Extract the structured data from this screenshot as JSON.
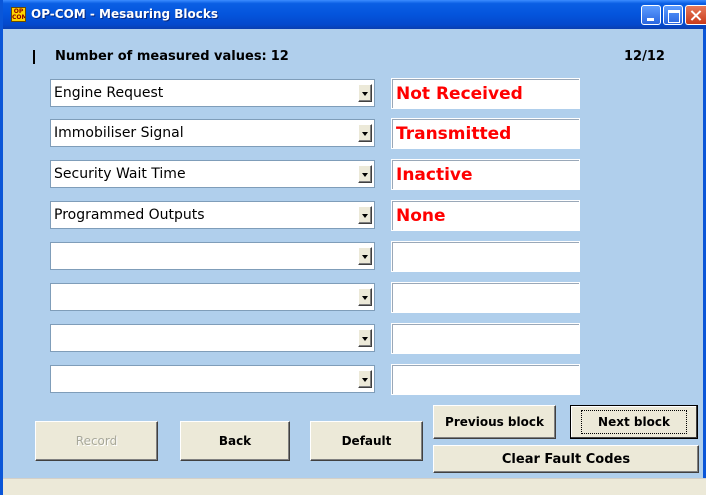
{
  "window": {
    "title": "OP-COM - Mesauring Blocks",
    "icon_text": "OP COM",
    "icon": "op-com-logo-icon",
    "controls": [
      "minimize-icon",
      "maximize-icon",
      "close-icon"
    ]
  },
  "header": {
    "count_label": "Number of measured values:",
    "count_value": "12",
    "page_indicator": "12/12"
  },
  "rows": [
    {
      "parameter": "Engine Request",
      "value": "Not Received"
    },
    {
      "parameter": "Immobiliser Signal",
      "value": "Transmitted"
    },
    {
      "parameter": "Security Wait Time",
      "value": "Inactive"
    },
    {
      "parameter": "Programmed Outputs",
      "value": "None"
    },
    {
      "parameter": "",
      "value": ""
    },
    {
      "parameter": "",
      "value": ""
    },
    {
      "parameter": "",
      "value": ""
    },
    {
      "parameter": "",
      "value": ""
    }
  ],
  "buttons": {
    "record": "Record",
    "back": "Back",
    "default": "Default",
    "previous_block": "Previous block",
    "next_block": "Next block",
    "clear_fault_codes": "Clear Fault Codes"
  },
  "colors": {
    "value_text": "#ff0000",
    "titlebar": "#0454dc",
    "window_background": "#b0cfec"
  }
}
